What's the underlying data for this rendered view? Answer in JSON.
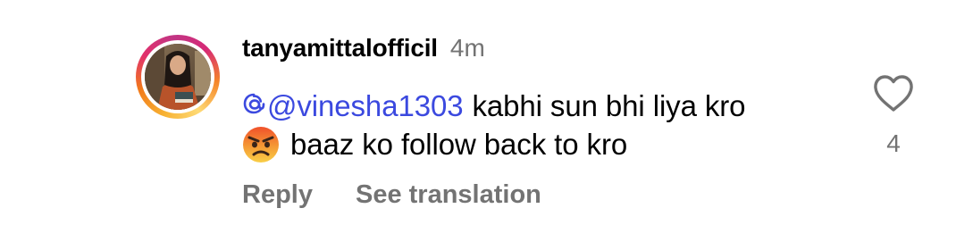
{
  "comment": {
    "username": "tanyamittalofficil",
    "time": "4m",
    "mention": "@vinesha1303",
    "text_line1": "kabhi sun bhi liya kro",
    "emoji": "angry-face",
    "text_line2": "baaz ko follow back to kro",
    "reply_label": "Reply",
    "translate_label": "See translation",
    "like_count": "4"
  },
  "colors": {
    "mention": "#3b49df",
    "muted": "#737373",
    "text": "#000000",
    "background": "#ffffff"
  },
  "icons": {
    "like": "heart-outline-icon",
    "mention": "threads-at-icon"
  }
}
